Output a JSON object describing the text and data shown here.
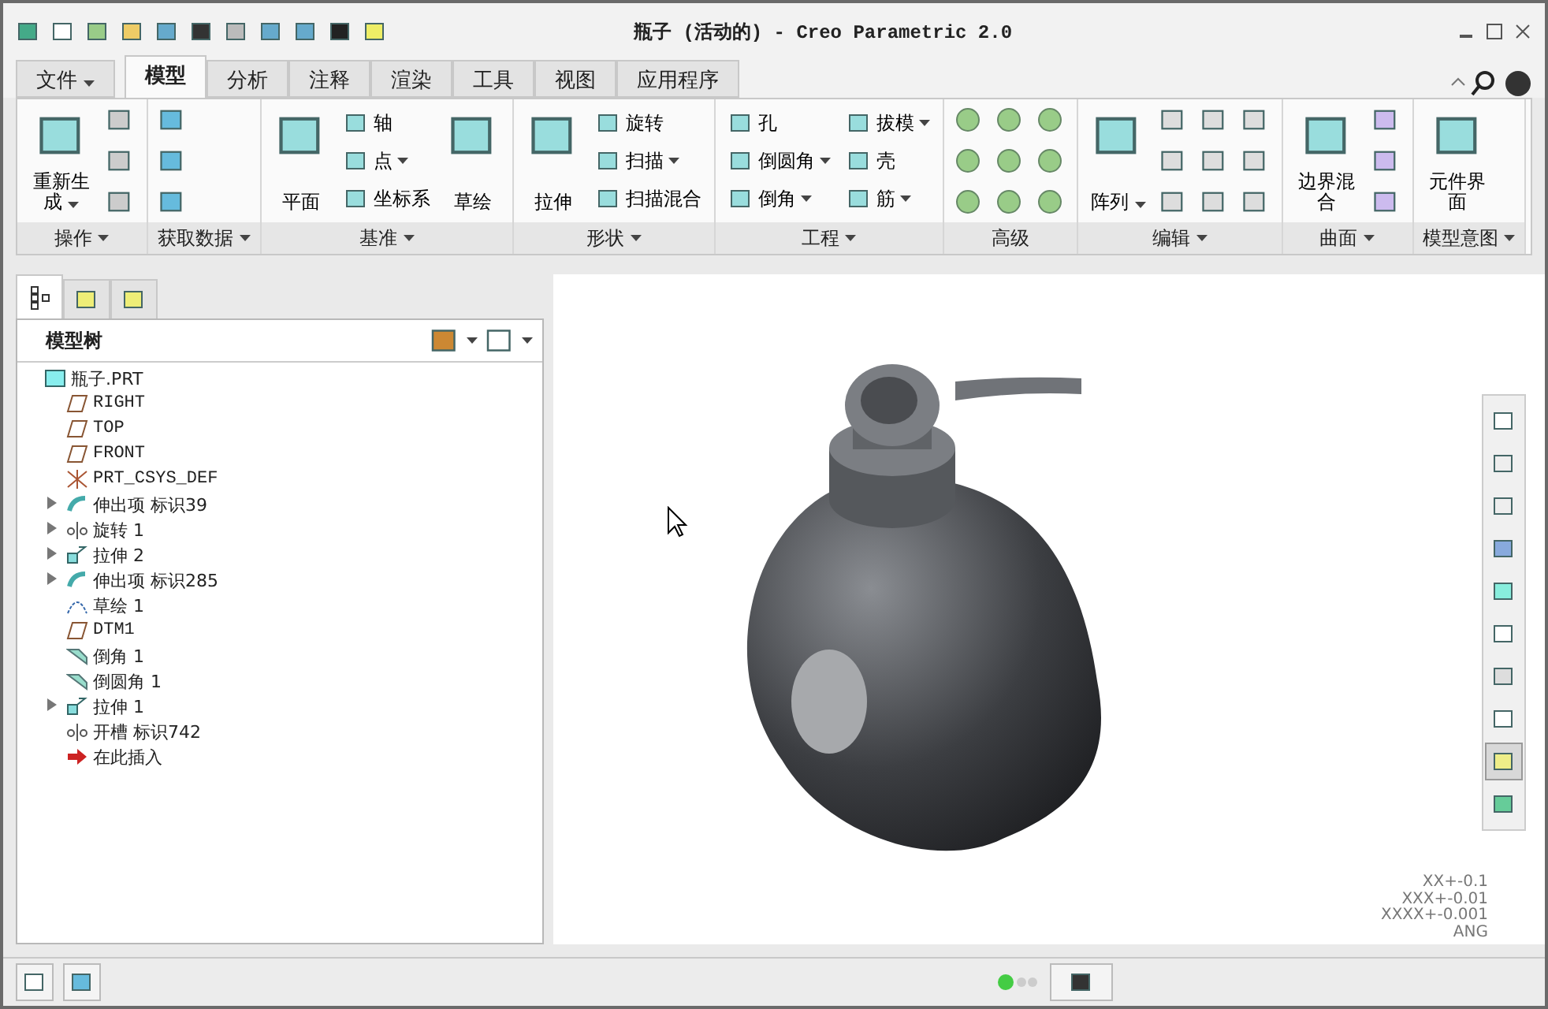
{
  "window": {
    "title": "瓶子 (活动的) - Creo Parametric 2.0"
  },
  "file_menu": {
    "label": "文件"
  },
  "tabs": [
    {
      "label": "模型",
      "selected": true
    },
    {
      "label": "分析",
      "selected": false
    },
    {
      "label": "注释",
      "selected": false
    },
    {
      "label": "渲染",
      "selected": false
    },
    {
      "label": "工具",
      "selected": false
    },
    {
      "label": "视图",
      "selected": false
    },
    {
      "label": "应用程序",
      "selected": false
    }
  ],
  "ribbon_groups": [
    {
      "label": "操作",
      "dropdown": true,
      "kind": "operations",
      "items": [
        {
          "label": "重新生成",
          "kind": "large",
          "dropdown": true
        }
      ]
    },
    {
      "label": "获取数据",
      "dropdown": true,
      "kind": "get_data"
    },
    {
      "label": "基准",
      "dropdown": true,
      "kind": "plain",
      "items": [
        {
          "label": "平面",
          "kind": "large",
          "dropdown": false
        },
        {
          "label": "轴",
          "kind": "small",
          "dropdown": false
        },
        {
          "label": "点",
          "kind": "small",
          "dropdown": true
        },
        {
          "label": "坐标系",
          "kind": "small",
          "dropdown": false
        },
        {
          "label": "草绘",
          "kind": "large",
          "dropdown": false
        }
      ]
    },
    {
      "label": "形状",
      "dropdown": true,
      "kind": "plain",
      "items": [
        {
          "label": "拉伸",
          "kind": "large",
          "dropdown": false
        },
        {
          "label": "旋转",
          "kind": "small",
          "dropdown": false
        },
        {
          "label": "扫描",
          "kind": "small",
          "dropdown": true
        },
        {
          "label": "扫描混合",
          "kind": "small",
          "dropdown": false
        }
      ]
    },
    {
      "label": "工程",
      "dropdown": true,
      "kind": "plain",
      "items": [
        {
          "label": "孔",
          "kind": "small",
          "dropdown": false
        },
        {
          "label": "倒圆角",
          "kind": "small",
          "dropdown": true
        },
        {
          "label": "倒角",
          "kind": "small",
          "dropdown": true
        },
        {
          "label": "拔模",
          "kind": "small",
          "dropdown": true
        },
        {
          "label": "壳",
          "kind": "small",
          "dropdown": false
        },
        {
          "label": "筋",
          "kind": "small",
          "dropdown": true
        }
      ]
    },
    {
      "label": "高级",
      "dropdown": false,
      "kind": "advanced"
    },
    {
      "label": "编辑",
      "dropdown": true,
      "kind": "edit",
      "items": [
        {
          "label": "阵列",
          "kind": "large",
          "dropdown": true
        }
      ]
    },
    {
      "label": "曲面",
      "dropdown": true,
      "kind": "surface",
      "items": [
        {
          "label": "边界混合",
          "kind": "large",
          "dropdown": false
        }
      ]
    },
    {
      "label": "模型意图",
      "dropdown": true,
      "kind": "plain",
      "items": [
        {
          "label": "元件界面",
          "kind": "large",
          "dropdown": false
        }
      ]
    }
  ],
  "panel_tabs": [
    {
      "selected": true
    },
    {
      "selected": false
    },
    {
      "selected": false
    }
  ],
  "model_tree": {
    "title": "模型树",
    "items": [
      {
        "label": "瓶子.PRT",
        "kind": "part",
        "children": [
          {
            "label": "RIGHT",
            "kind": "plane"
          },
          {
            "label": "TOP",
            "kind": "plane"
          },
          {
            "label": "FRONT",
            "kind": "plane"
          },
          {
            "label": "PRT_CSYS_DEF",
            "kind": "csys"
          },
          {
            "label": "伸出项 标识39",
            "kind": "protrusion",
            "expanded": false
          },
          {
            "label": "旋转 1",
            "kind": "revolve",
            "expanded": false
          },
          {
            "label": "拉伸 2",
            "kind": "extrude",
            "expanded": false
          },
          {
            "label": "伸出项 标识285",
            "kind": "sweep",
            "expanded": false
          },
          {
            "label": "草绘 1",
            "kind": "sketch"
          },
          {
            "label": "DTM1",
            "kind": "plane"
          },
          {
            "label": "倒角 1",
            "kind": "chamfer"
          },
          {
            "label": "倒圆角 1",
            "kind": "round"
          },
          {
            "label": "拉伸 1",
            "kind": "extrude",
            "expanded": false
          },
          {
            "label": "开槽 标识742",
            "kind": "revolve"
          },
          {
            "label": "在此插入",
            "kind": "insert"
          }
        ]
      }
    ]
  },
  "view_tools": [
    {
      "selected": false
    },
    {
      "selected": false
    },
    {
      "selected": false
    },
    {
      "selected": false
    },
    {
      "selected": false
    },
    {
      "selected": false
    },
    {
      "selected": false
    },
    {
      "selected": false
    },
    {
      "selected": true
    },
    {
      "selected": false
    }
  ],
  "tolerance_note": [
    "XX+-0.1",
    "XXX+-0.01",
    "XXXX+-0.001",
    "ANG"
  ]
}
